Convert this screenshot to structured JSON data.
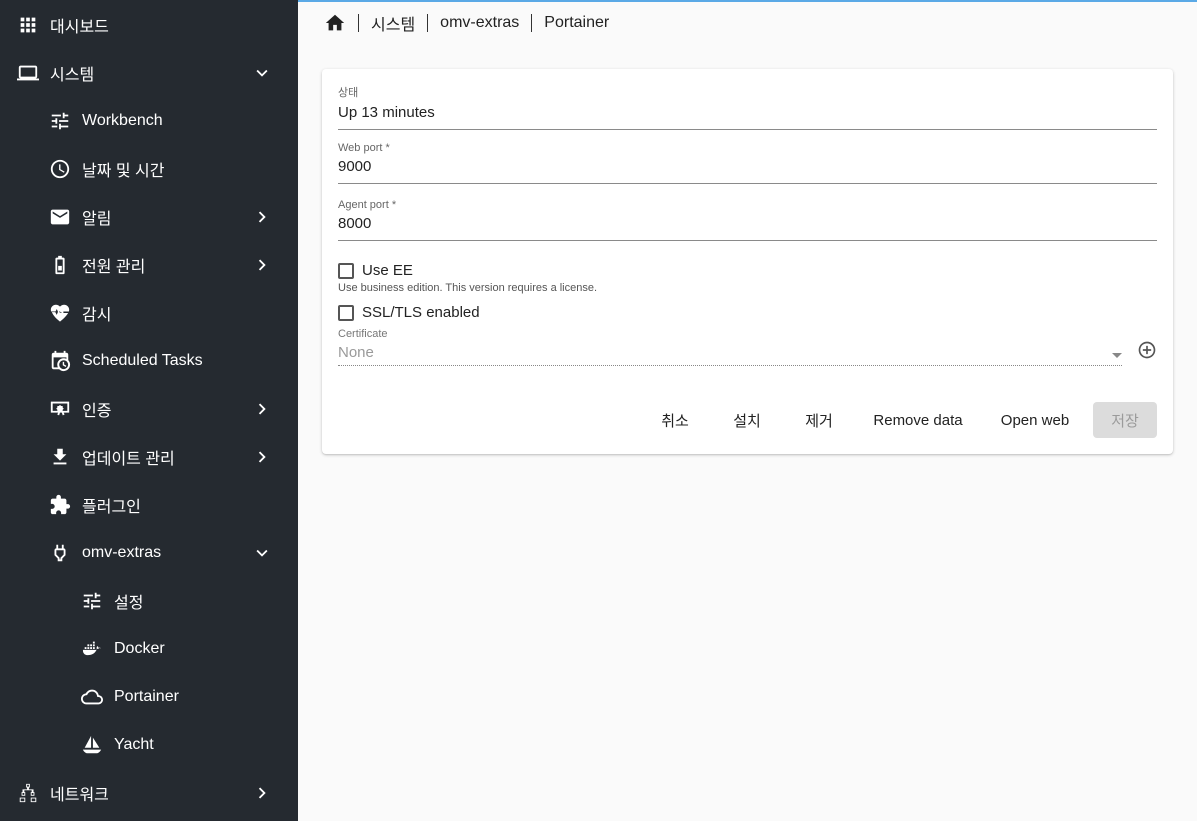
{
  "sidebar": {
    "items": [
      {
        "label": "대시보드",
        "icon": "apps-grid-icon"
      },
      {
        "label": "시스템",
        "icon": "laptop-icon"
      },
      {
        "label": "Workbench",
        "icon": "tune-icon"
      },
      {
        "label": "날짜 및 시간",
        "icon": "clock-icon"
      },
      {
        "label": "알림",
        "icon": "mail-icon"
      },
      {
        "label": "전원 관리",
        "icon": "battery-icon"
      },
      {
        "label": "감시",
        "icon": "heart-pulse-icon"
      },
      {
        "label": "Scheduled Tasks",
        "icon": "calendar-clock-icon"
      },
      {
        "label": "인증",
        "icon": "certificate-icon"
      },
      {
        "label": "업데이트 관리",
        "icon": "download-icon"
      },
      {
        "label": "플러그인",
        "icon": "puzzle-icon"
      },
      {
        "label": "omv-extras",
        "icon": "plug-icon"
      },
      {
        "label": "설정",
        "icon": "tune-icon"
      },
      {
        "label": "Docker",
        "icon": "docker-icon"
      },
      {
        "label": "Portainer",
        "icon": "cloud-icon"
      },
      {
        "label": "Yacht",
        "icon": "sailboat-icon"
      },
      {
        "label": "네트워크",
        "icon": "network-icon"
      }
    ]
  },
  "breadcrumb": {
    "items": [
      "시스템",
      "omv-extras",
      "Portainer"
    ]
  },
  "form": {
    "status_label": "상태",
    "status_value": "Up 13 minutes",
    "webport_label": "Web port *",
    "webport_value": "9000",
    "agentport_label": "Agent port *",
    "agentport_value": "8000",
    "use_ee_label": "Use EE",
    "use_ee_hint": "Use business edition. This version requires a license.",
    "ssl_label": "SSL/TLS enabled",
    "cert_label": "Certificate",
    "cert_value": "None"
  },
  "actions": {
    "cancel": "취소",
    "install": "설치",
    "remove": "제거",
    "remove_data": "Remove data",
    "open_web": "Open web",
    "save": "저장"
  },
  "colors": {
    "sidebar_bg": "#252a30",
    "accent": "#5aa9e6"
  }
}
